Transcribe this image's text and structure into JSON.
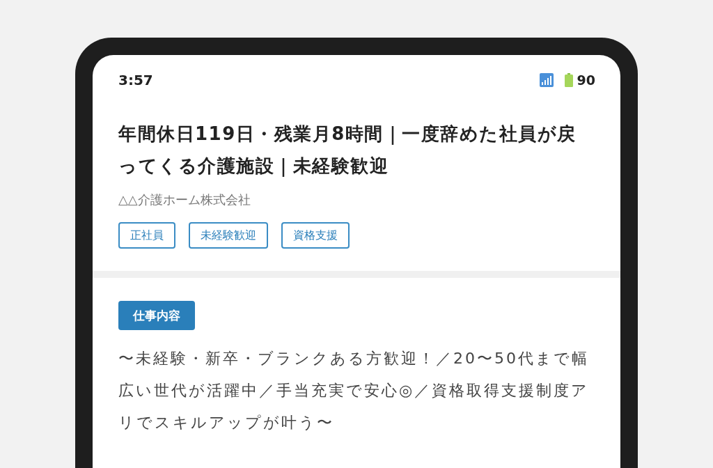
{
  "status_bar": {
    "time": "3:57",
    "battery": "90"
  },
  "job": {
    "title": "年間休日119日・残業月8時間｜一度辞めた社員が戻ってくる介護施設｜未経験歓迎",
    "company": "△△介護ホーム株式会社",
    "tags": [
      "正社員",
      "未経験歓迎",
      "資格支援"
    ]
  },
  "section": {
    "heading": "仕事内容",
    "body": "〜未経験・新卒・ブランクある方歓迎！／20〜50代まで幅広い世代が活躍中／手当充実で安心◎／資格取得支援制度アリでスキルアップが叶う〜"
  }
}
